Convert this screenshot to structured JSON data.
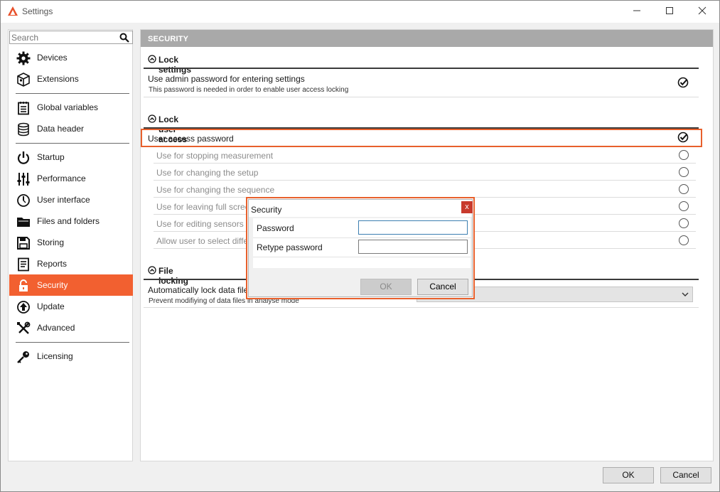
{
  "window": {
    "title": "Settings"
  },
  "search": {
    "placeholder": "Search"
  },
  "sidebar": {
    "items": [
      {
        "label": "Devices",
        "icon": "gear-icon"
      },
      {
        "label": "Extensions",
        "icon": "cube-icon"
      },
      {
        "label": "Global variables",
        "icon": "notepad-icon"
      },
      {
        "label": "Data header",
        "icon": "database-icon"
      },
      {
        "label": "Startup",
        "icon": "power-icon"
      },
      {
        "label": "Performance",
        "icon": "sliders-icon"
      },
      {
        "label": "User interface",
        "icon": "gauge-icon"
      },
      {
        "label": "Files and folders",
        "icon": "folder-icon"
      },
      {
        "label": "Storing",
        "icon": "floppy-icon"
      },
      {
        "label": "Reports",
        "icon": "report-icon"
      },
      {
        "label": "Security",
        "icon": "padlock-icon",
        "active": true
      },
      {
        "label": "Update",
        "icon": "update-icon"
      },
      {
        "label": "Advanced",
        "icon": "tools-icon"
      },
      {
        "label": "Licensing",
        "icon": "key-icon"
      }
    ]
  },
  "main": {
    "header": "SECURITY",
    "lock_settings": {
      "title": "Lock settings",
      "admin_password_label": "Use admin password for entering settings",
      "admin_password_desc": "This password is needed in order to enable user access locking",
      "admin_password_checked": true
    },
    "lock_user_access": {
      "title": "Lock user access",
      "user_password_label": "User access password",
      "user_password_checked": true,
      "options": [
        "Use for stopping measurement",
        "Use for changing the setup",
        "Use for changing the sequence",
        "Use for leaving full screen",
        "Use for editing sensors",
        "Allow user to select differe"
      ]
    },
    "file_locking": {
      "title": "File locking",
      "auto_lock_label": "Automatically lock data files a",
      "auto_lock_desc": "Prevent modifiying of data files in analyse mode"
    }
  },
  "footer": {
    "ok_label": "OK",
    "cancel_label": "Cancel"
  },
  "dialog": {
    "title": "Security",
    "close_label": "x",
    "password_label": "Password",
    "retype_label": "Retype password",
    "ok_label": "OK",
    "cancel_label": "Cancel"
  },
  "colors": {
    "accent": "#f26030",
    "header_gray": "#a9a9a9",
    "dialog_close": "#c83a2c"
  }
}
